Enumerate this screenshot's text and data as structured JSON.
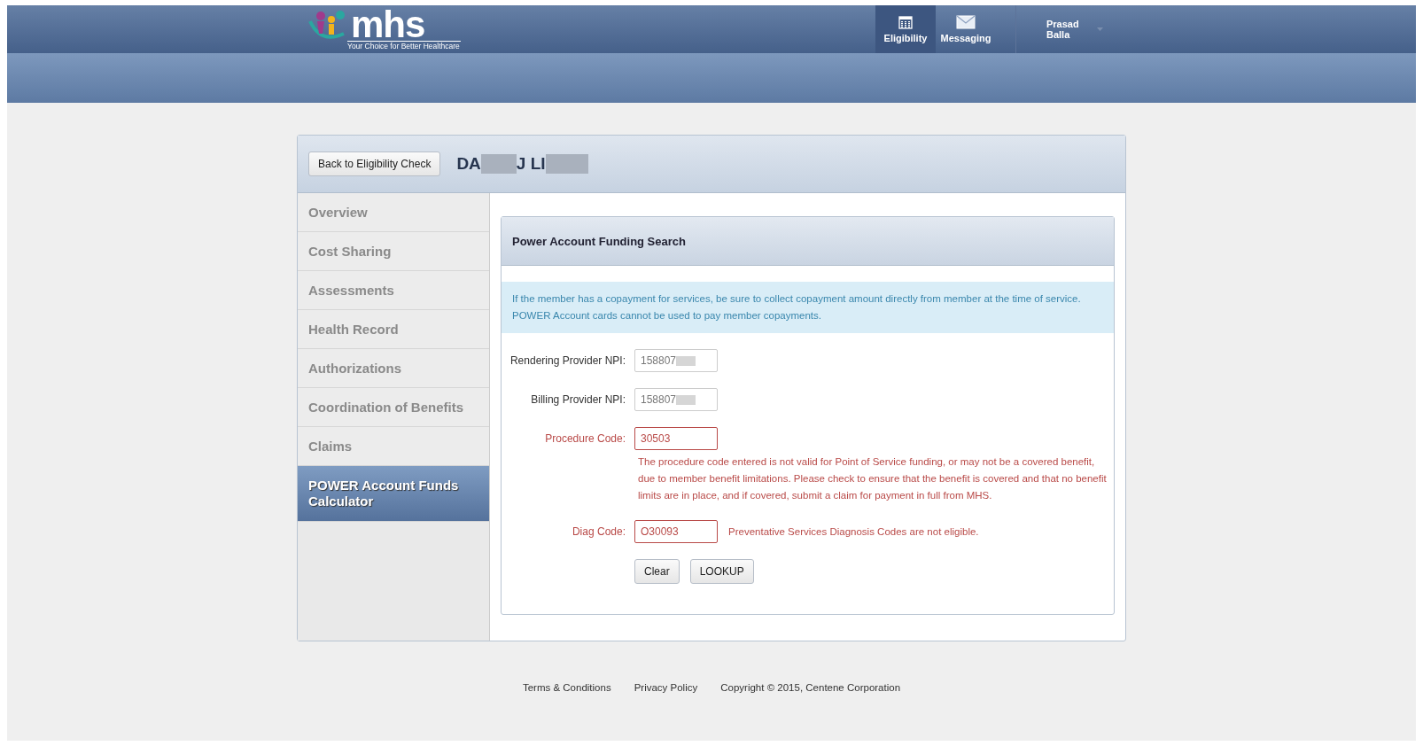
{
  "header": {
    "logo": "mhs",
    "tagline": "Your Choice for Better Healthcare",
    "nav": [
      {
        "label": "Eligibility",
        "kind": "calendar",
        "selected": true
      },
      {
        "label": "Messaging",
        "kind": "envelope",
        "selected": false
      }
    ],
    "user": [
      "Prasad",
      "Balla"
    ]
  },
  "member": {
    "back_button": "Back to Eligibility Check",
    "name_parts": [
      {
        "kind": "text",
        "text": "DA"
      },
      {
        "kind": "redacted"
      },
      {
        "kind": "text",
        "text": "J LI"
      },
      {
        "kind": "redacted"
      }
    ]
  },
  "sidebar": {
    "items": [
      {
        "label": "Overview",
        "selected": false
      },
      {
        "label": "Cost Sharing",
        "selected": false
      },
      {
        "label": "Assessments",
        "selected": false
      },
      {
        "label": "Health Record",
        "selected": false
      },
      {
        "label": "Authorizations",
        "selected": false
      },
      {
        "label": "Coordination of Benefits",
        "selected": false
      },
      {
        "label": "Claims",
        "selected": false
      },
      {
        "label": "POWER Account Funds Calculator",
        "selected": true
      }
    ]
  },
  "panel": {
    "title": "Power Account Funding Search",
    "notice": [
      "If the member has a copayment for services, be sure to collect copayment amount directly from member at the time of service.",
      "POWER Account cards cannot be used to pay member copayments."
    ],
    "fields": [
      {
        "label": "Rendering Provider NPI:",
        "value": "158807",
        "redacted": true,
        "error": false
      },
      {
        "label": "Billing Provider NPI:",
        "value": "158807",
        "redacted": true,
        "error": false
      },
      {
        "label": "Procedure Code:",
        "value": "30503",
        "redacted": false,
        "error": true,
        "message": "The procedure code entered is not valid for Point of Service funding, or may not be a covered benefit, due to member benefit limitations. Please check to ensure that the benefit is covered and that no benefit limits are in place, and if covered, submit a claim for payment in full from MHS.",
        "kind": "below"
      },
      {
        "label": "Diag Code:",
        "value": "O30093",
        "redacted": false,
        "error": true,
        "message": "Preventative Services Diagnosis Codes are not eligible.",
        "kind": "beside"
      }
    ],
    "buttons": [
      "Clear",
      "LOOKUP"
    ]
  },
  "footer": [
    "Terms & Conditions",
    "Privacy Policy",
    "Copyright © 2015, Centene Corporation"
  ]
}
